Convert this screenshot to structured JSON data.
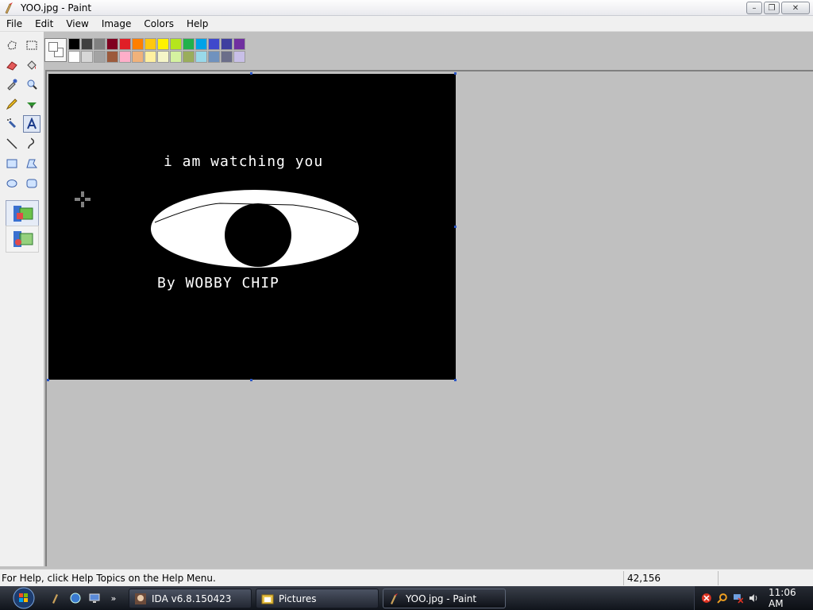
{
  "window": {
    "title": "YOO.jpg - Paint"
  },
  "menu": [
    "File",
    "Edit",
    "View",
    "Image",
    "Colors",
    "Help"
  ],
  "palette": {
    "row1": [
      "#000000",
      "#404040",
      "#808080",
      "#800020",
      "#e01f26",
      "#ff7f00",
      "#ffc80e",
      "#fff200",
      "#b5e61d",
      "#22b14c",
      "#00a2e8",
      "#3f48cc",
      "#3f3f9f",
      "#7030a0"
    ],
    "row2": [
      "#ffffff",
      "#d7d7d7",
      "#a3a3a3",
      "#9c5a3c",
      "#ffaec9",
      "#f0b27a",
      "#fff0a0",
      "#f5f5c8",
      "#d5f2a0",
      "#9aad5c",
      "#99d9ea",
      "#7092be",
      "#6b6e8a",
      "#c8bfe7"
    ]
  },
  "canvas_image": {
    "caption_top": "i am watching you",
    "caption_bottom": "By WOBBY CHIP"
  },
  "status": {
    "help_text": "For Help, click Help Topics on the Help Menu.",
    "coords": "42,156"
  },
  "taskbar": {
    "tasks": [
      {
        "label": "IDA v6.8.150423"
      },
      {
        "label": "Pictures"
      },
      {
        "label": "YOO.jpg - Paint"
      }
    ],
    "clock": "11:06 AM"
  }
}
